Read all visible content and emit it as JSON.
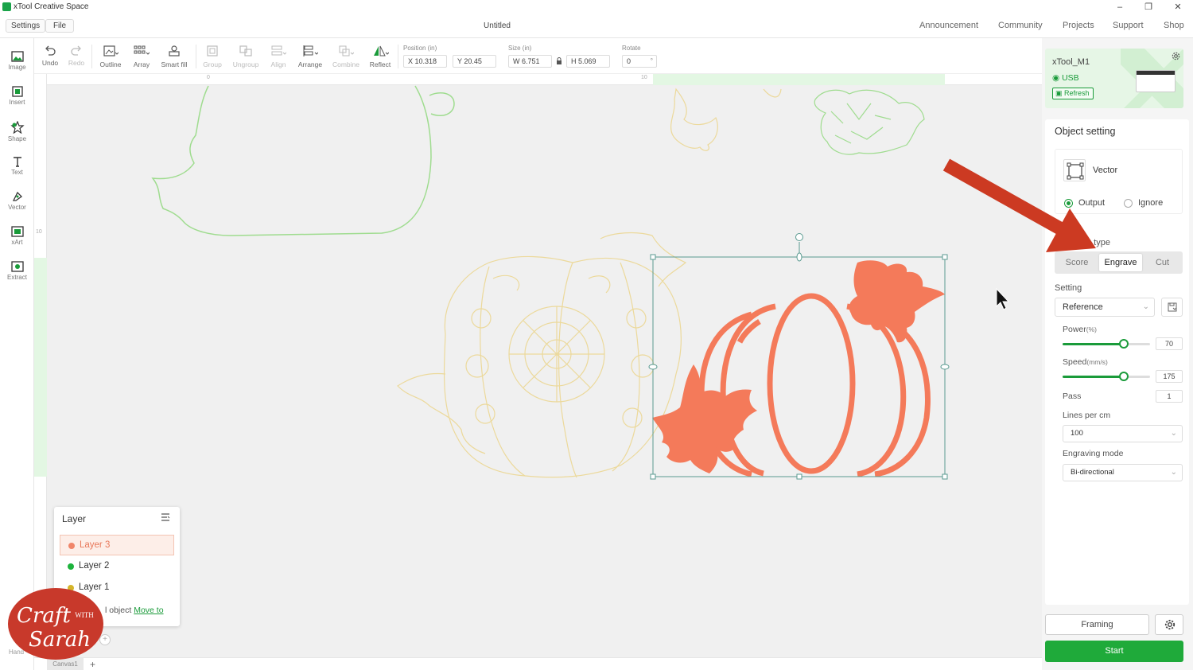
{
  "app": {
    "title": "xTool Creative Space",
    "document_title": "Untitled"
  },
  "menu": {
    "settings": "Settings",
    "file": "File"
  },
  "nav": [
    "Announcement",
    "Community",
    "Projects",
    "Support",
    "Shop"
  ],
  "left_tools": [
    {
      "label": "Image",
      "icon": "image-icon"
    },
    {
      "label": "Insert",
      "icon": "insert-icon"
    },
    {
      "label": "Shape",
      "icon": "shape-icon"
    },
    {
      "label": "Text",
      "icon": "text-icon"
    },
    {
      "label": "Vector",
      "icon": "vector-pen-icon"
    },
    {
      "label": "xArt",
      "icon": "xart-icon"
    },
    {
      "label": "Extract",
      "icon": "extract-icon"
    }
  ],
  "toolbar": {
    "undo": "Undo",
    "redo": "Redo",
    "outline": "Outline",
    "array": "Array",
    "smart_fill": "Smart fill",
    "group": "Group",
    "ungroup": "Ungroup",
    "align": "Align",
    "arrange": "Arrange",
    "combine": "Combine",
    "reflect": "Reflect",
    "position_label": "Position (in)",
    "x": "X 10.318",
    "y": "Y 20.45",
    "size_label": "Size (in)",
    "w": "W 6.751",
    "h": "H 5.069",
    "rotate_label": "Rotate",
    "rotate": "0",
    "rotate_unit": "°"
  },
  "ruler": {
    "h_labels": [
      "0",
      "10"
    ],
    "v_label": "10"
  },
  "layer_panel": {
    "title": "Layer",
    "layers": [
      {
        "name": "Layer 3",
        "color": "#f0866a",
        "active": true
      },
      {
        "name": "Layer 2",
        "color": "#1db33c",
        "active": false
      },
      {
        "name": "Layer 1",
        "color": "#d4b52a",
        "active": false
      }
    ],
    "footer_text": "l object",
    "footer_link": "Move to"
  },
  "bottom": {
    "canvas_tab": "Canvas1",
    "add": "+",
    "hand_label": "Hand",
    "hand_add": "+"
  },
  "watermark": {
    "line1": "Craft",
    "line2": "WITH",
    "line3": "Sarah"
  },
  "device": {
    "name": "xTool_M1",
    "connection": "USB",
    "refresh": "Refresh"
  },
  "object_setting": {
    "title": "Object setting",
    "object_type": "Vector",
    "output_label": "Output",
    "ignore_label": "Ignore",
    "output_selected": true,
    "processing_type_label": "g type",
    "processing_types": [
      "Score",
      "Engrave",
      "Cut"
    ],
    "selected_type": "Engrave",
    "setting_label": "Setting",
    "setting_value": "Reference",
    "power_label": "Power",
    "power_unit": "(%)",
    "power": "70",
    "power_fraction": 0.7,
    "speed_label": "Speed",
    "speed_unit": "(mm/s)",
    "speed": "175",
    "speed_fraction": 0.7,
    "pass_label": "Pass",
    "pass": "1",
    "lines_label": "Lines per cm",
    "lines_value": "100",
    "mode_label": "Engraving mode",
    "mode_value": "Bi-directional"
  },
  "actions": {
    "framing": "Framing",
    "start": "Start"
  },
  "colors": {
    "accent": "#1faa3a",
    "engrave_shape": "#f47a5a",
    "layer2_outline": "#9fdc8f",
    "layer1_outline": "#ecd99b",
    "annotation_arrow": "#cc3a22",
    "selection": "#5a9a90"
  }
}
